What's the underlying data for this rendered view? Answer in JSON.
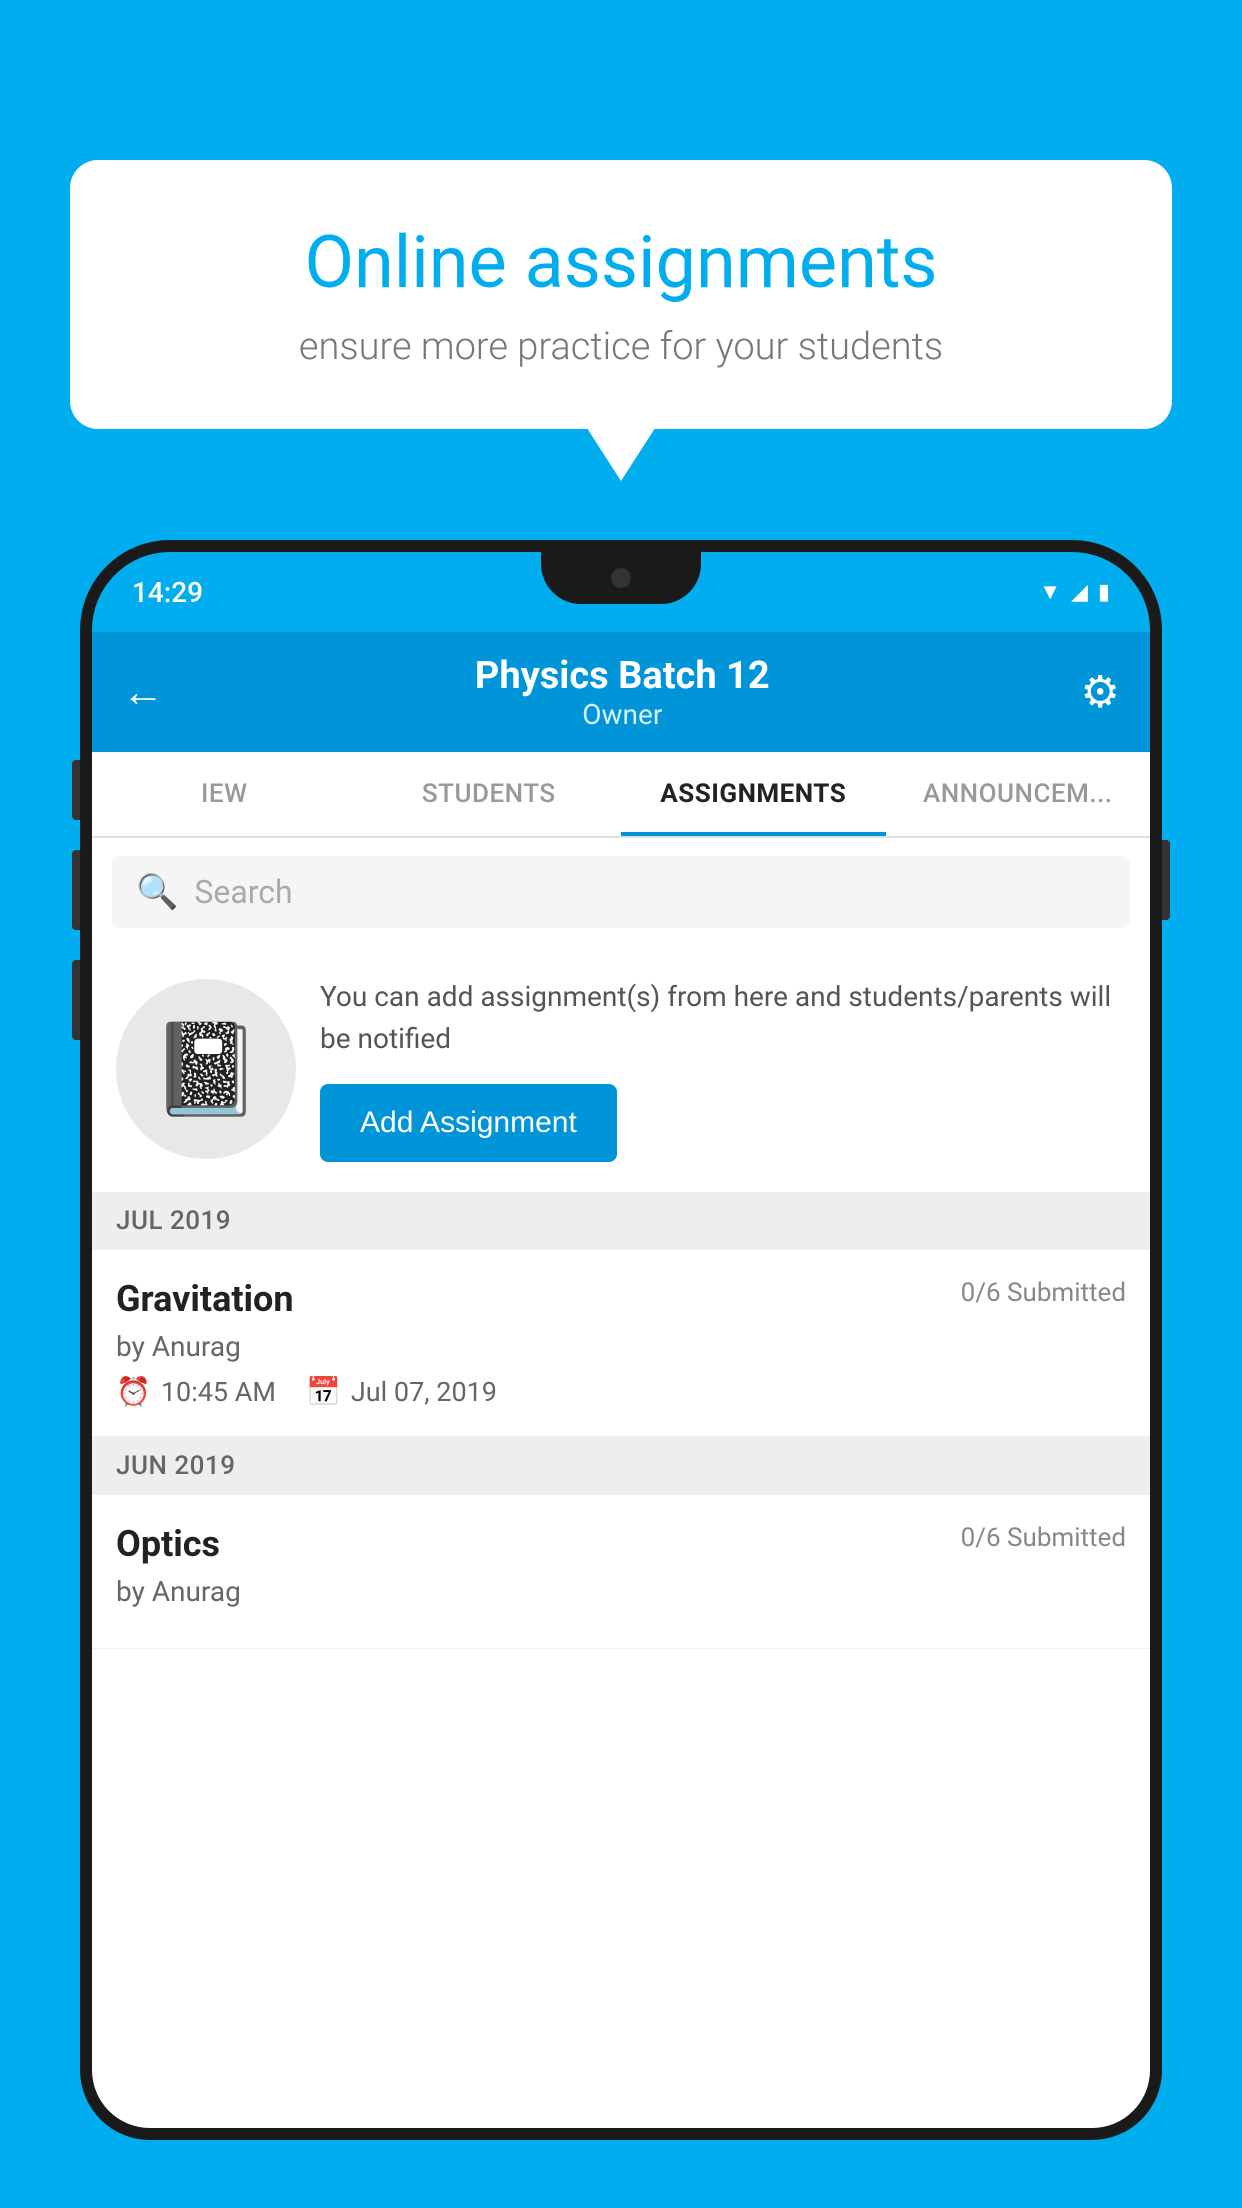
{
  "background_color": "#00AEEF",
  "speech_bubble": {
    "title": "Online assignments",
    "subtitle": "ensure more practice for your students"
  },
  "phone": {
    "status_bar": {
      "time": "14:29",
      "icons": [
        "wifi",
        "signal",
        "battery"
      ]
    },
    "header": {
      "back_label": "←",
      "batch_name": "Physics Batch 12",
      "owner_label": "Owner",
      "settings_label": "⚙"
    },
    "tabs": [
      {
        "label": "IEW",
        "active": false
      },
      {
        "label": "STUDENTS",
        "active": false
      },
      {
        "label": "ASSIGNMENTS",
        "active": true
      },
      {
        "label": "ANNOUNCEM...",
        "active": false
      }
    ],
    "search": {
      "placeholder": "Search"
    },
    "promo": {
      "icon": "📓",
      "description": "You can add assignment(s) from here and students/parents will be notified",
      "button_label": "Add Assignment"
    },
    "assignment_groups": [
      {
        "month": "JUL 2019",
        "assignments": [
          {
            "title": "Gravitation",
            "submitted": "0/6 Submitted",
            "by": "by Anurag",
            "time": "10:45 AM",
            "date": "Jul 07, 2019"
          }
        ]
      },
      {
        "month": "JUN 2019",
        "assignments": [
          {
            "title": "Optics",
            "submitted": "0/6 Submitted",
            "by": "by Anurag",
            "time": "",
            "date": ""
          }
        ]
      }
    ]
  }
}
